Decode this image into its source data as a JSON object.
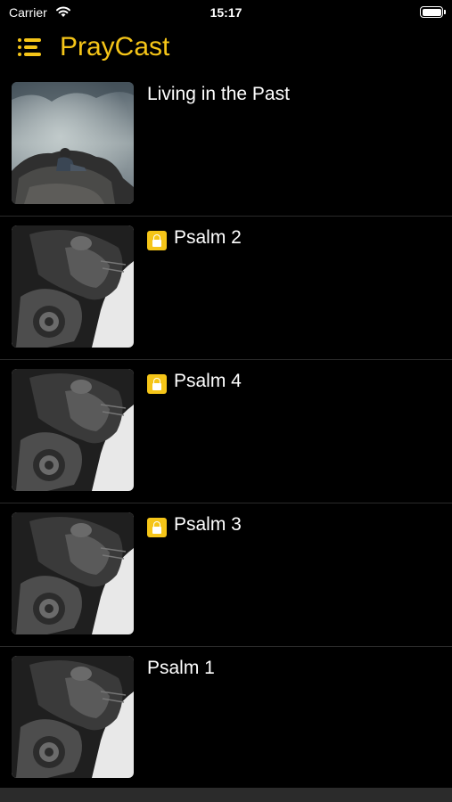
{
  "status_bar": {
    "carrier": "Carrier",
    "time": "15:17"
  },
  "header": {
    "title": "PrayCast",
    "accent_color": "#f5c518"
  },
  "episodes": [
    {
      "title": "Living in the Past",
      "locked": false,
      "thumbnail": "man-on-rock-image"
    },
    {
      "title": "Psalm 2",
      "locked": true,
      "thumbnail": "praying-man-image"
    },
    {
      "title": "Psalm 4",
      "locked": true,
      "thumbnail": "praying-man-image"
    },
    {
      "title": "Psalm 3",
      "locked": true,
      "thumbnail": "praying-man-image"
    },
    {
      "title": "Psalm 1",
      "locked": false,
      "thumbnail": "praying-man-image"
    }
  ]
}
